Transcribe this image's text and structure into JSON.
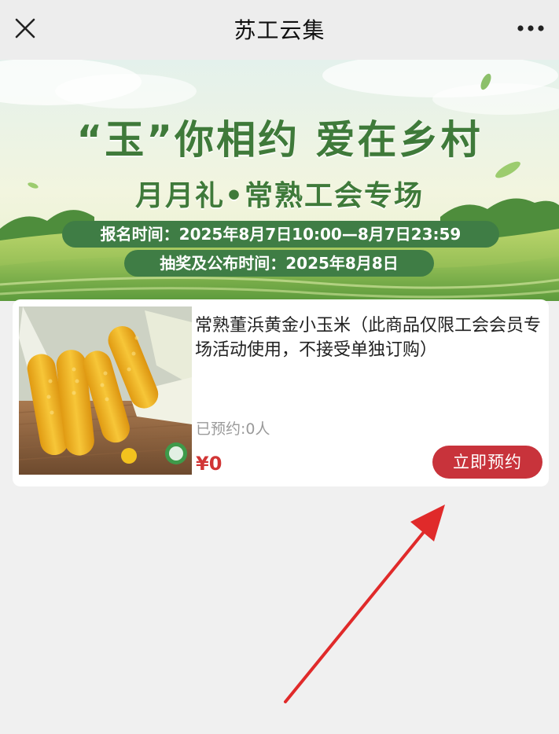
{
  "navbar": {
    "title": "苏工云集",
    "close_icon": "close-icon",
    "more_icon": "more-dots-icon"
  },
  "banner": {
    "headline": "“玉”你相约  爱在乡村",
    "subheadline": "月月礼•常熟工会专场",
    "signup_time": "报名时间：2025年8月7日10:00—8月7日23:59",
    "lottery_time": "抽奖及公布时间：2025年8月8日"
  },
  "product": {
    "title": "常熟董浜黄金小玉米（此商品仅限工会会员专场活动使用，不接受单独订购）",
    "reserved_count": "已预约:0人",
    "price": "¥0",
    "reserve_button": "立即预约"
  },
  "colors": {
    "navbar_bg": "#ededed",
    "banner_text": "#3f7a3a",
    "pill_bg": "#3f7d45",
    "price": "#d13535",
    "button_bg": "#c8333b",
    "arrow": "#e02a2a",
    "page_bg": "#f0f0f0"
  }
}
